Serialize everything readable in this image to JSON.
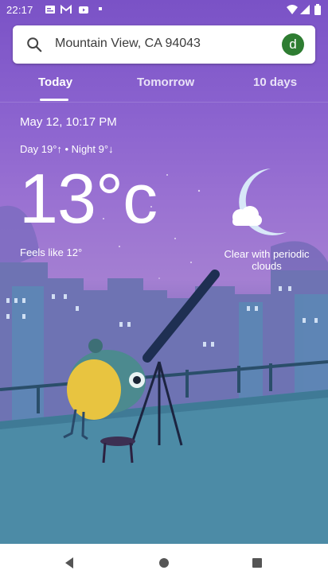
{
  "status_bar": {
    "time": "22:17",
    "icons": [
      "google-news-icon",
      "m-icon",
      "youtube-icon",
      "dot-icon",
      "wifi-icon",
      "signal-icon",
      "battery-icon"
    ]
  },
  "search": {
    "location": "Mountain View, CA 94043",
    "avatar_letter": "d",
    "avatar_color": "#2e7d32"
  },
  "tabs": [
    {
      "label": "Today",
      "selected": true
    },
    {
      "label": "Tomorrow",
      "selected": false
    },
    {
      "label": "10 days",
      "selected": false
    }
  ],
  "weather": {
    "date_time": "May 12, 10:17 PM",
    "day_night": "Day 19°↑ • Night 9°↓",
    "temperature": "13°c",
    "feels_like": "Feels like 12°",
    "condition": "Clear with periodic clouds"
  },
  "nav": {
    "buttons": [
      "back-icon",
      "home-icon",
      "recents-icon"
    ]
  },
  "colors": {
    "sky_top": "#7a52c6",
    "sky_bottom": "#4f8aa6",
    "accent_avatar": "#2e7d32"
  }
}
